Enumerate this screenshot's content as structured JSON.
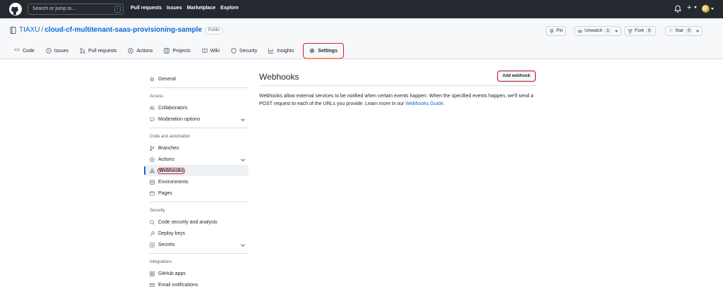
{
  "header": {
    "search_placeholder": "Search or jump to...",
    "search_key": "/",
    "nav": [
      "Pull requests",
      "Issues",
      "Marketplace",
      "Explore"
    ],
    "plus": "+"
  },
  "repo": {
    "owner": "TIAXU",
    "separator": "/",
    "name": "cloud-cf-multitenant-saas-provisioning-sample",
    "visibility": "Public",
    "actions": {
      "pin_label": "Pin",
      "unwatch_label": "Unwatch",
      "unwatch_count": "1",
      "fork_label": "Fork",
      "fork_count": "0",
      "star_label": "Star",
      "star_count": "0"
    },
    "tabs": [
      {
        "label": "Code",
        "icon": "code-icon"
      },
      {
        "label": "Issues",
        "icon": "issue-icon"
      },
      {
        "label": "Pull requests",
        "icon": "pull-request-icon"
      },
      {
        "label": "Actions",
        "icon": "play-icon"
      },
      {
        "label": "Projects",
        "icon": "table-icon"
      },
      {
        "label": "Wiki",
        "icon": "book-icon"
      },
      {
        "label": "Security",
        "icon": "shield-icon"
      },
      {
        "label": "Insights",
        "icon": "graph-icon"
      },
      {
        "label": "Settings",
        "icon": "gear-icon"
      }
    ],
    "active_tab": "Settings"
  },
  "sidebar": {
    "general": "General",
    "access_heading": "Access",
    "collaborators": "Collaborators",
    "moderation": "Moderation options",
    "code_heading": "Code and automation",
    "branches": "Branches",
    "actions": "Actions",
    "webhooks": "Webhooks",
    "environments": "Environments",
    "pages": "Pages",
    "security_heading": "Security",
    "code_security": "Code security and analysis",
    "deploy_keys": "Deploy keys",
    "secrets": "Secrets",
    "integrations_heading": "Integrations",
    "github_apps": "GitHub apps",
    "email_notifications": "Email notifications"
  },
  "main": {
    "title": "Webhooks",
    "add_button": "Add webhook",
    "description": "Webhooks allow external services to be notified when certain events happen. When the specified events happen, we'll send a POST request to each of the URLs you provide. Learn more in our ",
    "guide_link": "Webhooks Guide",
    "description_end": "."
  },
  "colors": {
    "header_bg": "#24292f",
    "link": "#0969da",
    "highlight": "#d1242f",
    "active_tab_underline": "#fd8c73"
  }
}
